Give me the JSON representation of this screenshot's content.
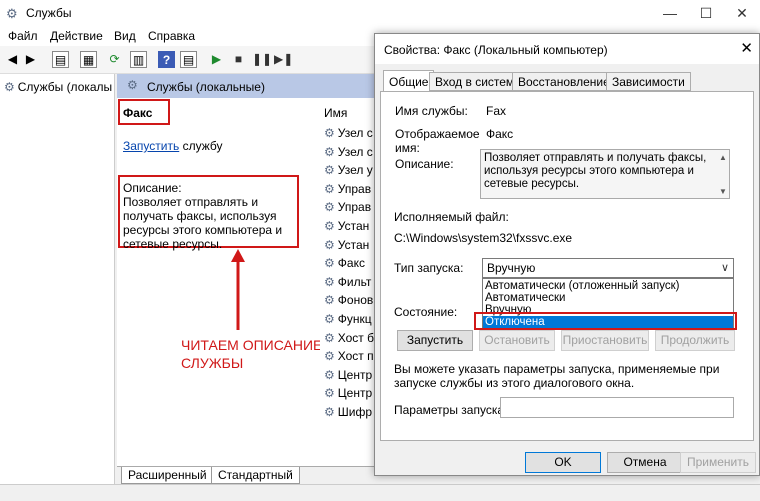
{
  "window": {
    "title": "Службы",
    "min": "—",
    "max": "☐",
    "close": "✕"
  },
  "menu": [
    "Файл",
    "Действие",
    "Вид",
    "Справка"
  ],
  "tree": {
    "item": "Службы (локалы"
  },
  "center": {
    "header": "Службы (локальные)",
    "service_name": "Факс",
    "start_link": "Запустить",
    "start_suffix": " службу",
    "desc_label": "Описание:",
    "desc_text": "Позволяет отправлять и получать факсы, используя ресурсы этого компьютера и сетевые ресурсы.",
    "column_name": "Имя",
    "annotation_line1": "ЧИТАЕМ ОПИСАНИЕ",
    "annotation_line2": "СЛУЖБЫ"
  },
  "services": [
    "Узел с",
    "Узел с",
    "Узел у",
    "Управ",
    "Управ",
    "Устан",
    "Устан",
    "Факс",
    "Фильт",
    "Фонов",
    "Функц",
    "Хост б",
    "Хост п",
    "Центр",
    "Центр",
    "Шифр"
  ],
  "bottom_tabs": [
    "Расширенный",
    "Стандартный"
  ],
  "dialog": {
    "title": "Свойства: Факс (Локальный компьютер)",
    "close": "✕",
    "tabs": [
      "Общие",
      "Вход в систему",
      "Восстановление",
      "Зависимости"
    ],
    "service_name_label": "Имя службы:",
    "service_name_value": "Fax",
    "display_name_label": "Отображаемое имя:",
    "display_name_value": "Факс",
    "description_label": "Описание:",
    "description_value": "Позволяет отправлять и получать факсы, используя ресурсы этого компьютера и сетевые ресурсы.",
    "exe_label": "Исполняемый файл:",
    "exe_value": "C:\\Windows\\system32\\fxssvc.exe",
    "startup_type_label": "Тип запуска:",
    "startup_type_value": "Вручную",
    "startup_options": [
      "Автоматически (отложенный запуск)",
      "Автоматически",
      "Вручную",
      "Отключена"
    ],
    "status_label": "Состояние:",
    "buttons": {
      "start": "Запустить",
      "stop": "Остановить",
      "pause": "Приостановить",
      "resume": "Продолжить"
    },
    "hint": "Вы можете указать параметры запуска, применяемые при запуске службы из этого диалогового окна.",
    "params_label": "Параметры запуска:",
    "params_value": "",
    "ok": "OK",
    "cancel": "Отмена",
    "apply": "Применить"
  }
}
